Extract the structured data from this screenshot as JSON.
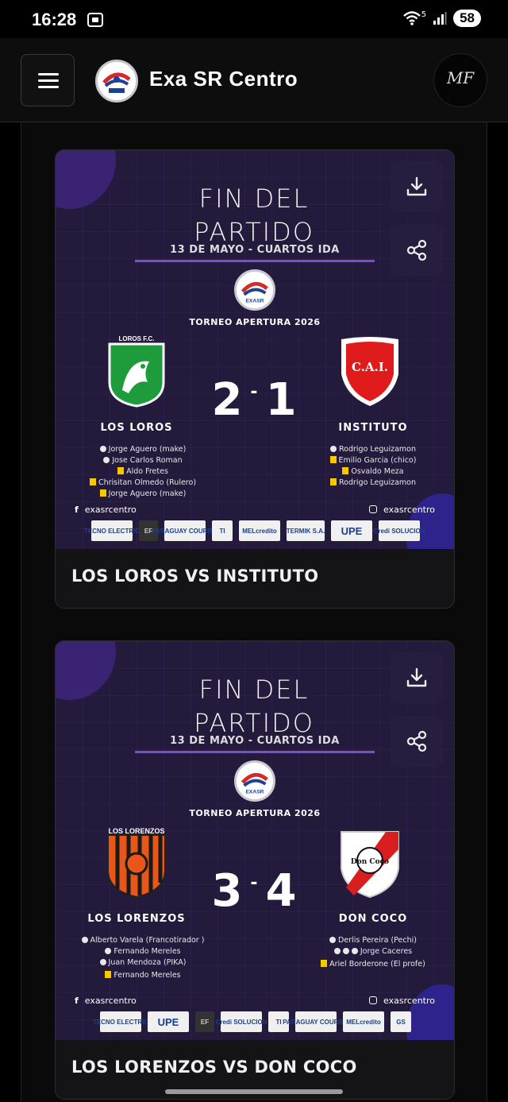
{
  "status_bar": {
    "time": "16:28",
    "battery": "58",
    "signal_badge": "5"
  },
  "header": {
    "brand": "Exa SR Centro",
    "avatar_initials": "MF"
  },
  "icons": {
    "menu": "hamburger-icon",
    "download": "download-icon",
    "share": "share-icon"
  },
  "cards": [
    {
      "headline_line1": "FIN DEL",
      "headline_line2": "PARTIDO",
      "date": "13 DE MAYO - CUARTOS IDA",
      "logo_text": "EXASR",
      "tournament": "TORNEO APERTURA 2026",
      "home": {
        "name": "LOS LOROS",
        "crest_label": "LOROS F.C.",
        "score": "2",
        "events": [
          {
            "type": "goal",
            "text": "Jorge Aguero (make)"
          },
          {
            "type": "goal",
            "text": "Jose Carlos Roman"
          },
          {
            "type": "card",
            "text": "Aldo Fretes"
          },
          {
            "type": "card",
            "text": "Chrisitan Olmedo (Rulero)"
          },
          {
            "type": "card",
            "text": "Jorge Aguero (make)"
          }
        ]
      },
      "away": {
        "name": "INSTITUTO",
        "crest_label": "C.A.I.",
        "score": "1",
        "events": [
          {
            "type": "goal",
            "text": "Rodrigo Leguizamon"
          },
          {
            "type": "card",
            "text": "Emilio Garcia (chico)"
          },
          {
            "type": "card",
            "text": "Osvaldo Meza"
          },
          {
            "type": "card",
            "text": "Rodrigo Leguizamon"
          }
        ]
      },
      "social_facebook": "exasrcentro",
      "social_instagram": "exasrcentro",
      "sponsors": [
        "TECNO ELECTRIC",
        "EF",
        "PARAGUAY COURIER",
        "TI",
        "MELcredito",
        "TERMIK S.A.",
        "UPE",
        "Credi SOLUCION"
      ],
      "title": "LOS LOROS VS INSTITUTO"
    },
    {
      "headline_line1": "FIN DEL",
      "headline_line2": "PARTIDO",
      "date": "13 DE MAYO - CUARTOS IDA",
      "logo_text": "EXASR",
      "tournament": "TORNEO APERTURA 2026",
      "home": {
        "name": "LOS LORENZOS",
        "crest_label": "LOS LORENZOS",
        "score": "3",
        "events": [
          {
            "type": "goal",
            "text": "Alberto Varela (Francotirador )"
          },
          {
            "type": "goal",
            "text": "Fernando Mereles"
          },
          {
            "type": "goal",
            "text": "Juan Mendoza (PIKA)"
          },
          {
            "type": "card",
            "text": "Fernando Mereles"
          }
        ]
      },
      "away": {
        "name": "DON COCO",
        "crest_label": "Don Coco",
        "score": "4",
        "events": [
          {
            "type": "goal",
            "text": "Derlis Pereira (Pechi)"
          },
          {
            "type": "goal3",
            "text": "Jorge Caceres"
          },
          {
            "type": "card",
            "text": "Ariel Borderone (El profe)"
          }
        ]
      },
      "social_facebook": "exasrcentro",
      "social_instagram": "exasrcentro",
      "sponsors": [
        "TECNO ELECTRIC",
        "UPE",
        "EF",
        "Credi SOLUCION",
        "TI",
        "PARAGUAY COURIER",
        "MELcredito",
        "GS"
      ],
      "title": "LOS LORENZOS VS DON COCO"
    }
  ]
}
